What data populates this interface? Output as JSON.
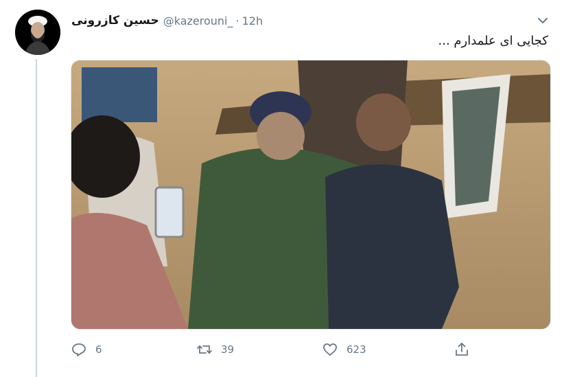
{
  "tweet": {
    "display_name": "حسین کازرونی",
    "handle": "@kazerouni_",
    "separator": "·",
    "time": "12h",
    "text": "کجایی ای علمدارم ...",
    "avatar_icon": "profile-avatar",
    "menu_icon": "chevron-down-icon",
    "media_description_icon": "photo"
  },
  "actions": {
    "reply_count": "6",
    "retweet_count": "39",
    "like_count": "623"
  },
  "colors": {
    "text": "#14171a",
    "secondary": "#657786",
    "thread_line": "#ccd6dd"
  }
}
